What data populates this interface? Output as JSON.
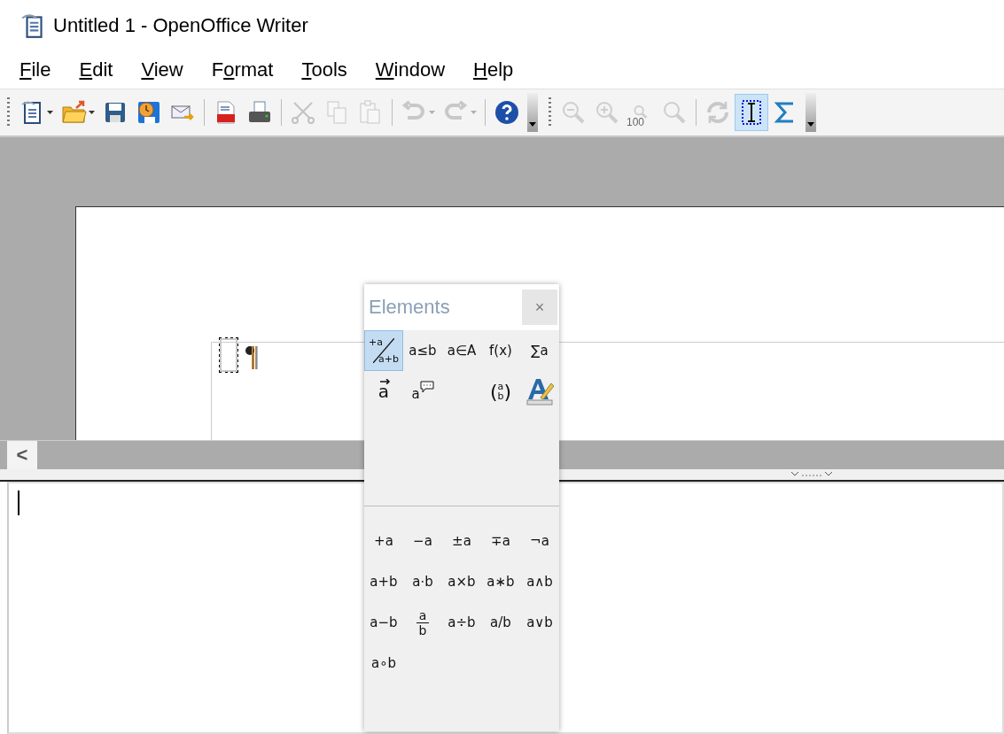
{
  "window": {
    "title": "Untitled 1 - OpenOffice Writer"
  },
  "menu": [
    {
      "key": "F",
      "post": "ile"
    },
    {
      "key": "E",
      "post": "dit"
    },
    {
      "key": "V",
      "post": "iew"
    },
    {
      "pre": "F",
      "key": "o",
      "post": "rmat"
    },
    {
      "key": "T",
      "post": "ools"
    },
    {
      "key": "W",
      "post": "indow"
    },
    {
      "key": "H",
      "post": "elp"
    }
  ],
  "toolbars": [
    {
      "groups": [
        [
          {
            "disabled": false,
            "selected": false,
            "dropdown": true
          },
          {
            "disabled": false,
            "selected": false,
            "dropdown": true
          },
          {
            "disabled": false,
            "selected": false
          },
          {
            "disabled": false,
            "selected": false
          },
          {
            "disabled": false,
            "selected": false
          }
        ],
        [
          {
            "disabled": false,
            "selected": false
          },
          {
            "disabled": false,
            "selected": false
          }
        ],
        [
          {
            "disabled": true,
            "selected": false
          },
          {
            "disabled": true,
            "selected": false
          },
          {
            "disabled": true,
            "selected": false
          }
        ],
        [
          {
            "disabled": true,
            "selected": false,
            "dropdown": true
          },
          {
            "disabled": true,
            "selected": false,
            "dropdown": true
          }
        ],
        [
          {
            "disabled": false,
            "selected": false
          }
        ]
      ]
    },
    {
      "groups": [
        [
          {
            "disabled": true,
            "selected": false
          },
          {
            "disabled": true,
            "selected": false
          },
          {
            "disabled": true,
            "selected": false,
            "label": "100"
          },
          {
            "disabled": true,
            "selected": false
          }
        ],
        [
          {
            "disabled": true,
            "selected": false
          },
          {
            "disabled": false,
            "selected": true
          },
          {
            "disabled": false,
            "selected": false
          }
        ]
      ]
    }
  ],
  "elements_panel": {
    "title": "Elements",
    "close": "×",
    "categories": [
      {
        "kind": "slash-fraction",
        "top": "+a",
        "bottom": "a+b",
        "selected": true
      },
      {
        "kind": "text",
        "label": "a≤b",
        "selected": false
      },
      {
        "kind": "text",
        "label": "a∈A",
        "selected": false
      },
      {
        "kind": "text",
        "label": "f(x)",
        "selected": false
      },
      {
        "kind": "text",
        "label": "∑a",
        "selected": false
      },
      {
        "kind": "vector",
        "label": "a",
        "selected": false
      },
      {
        "kind": "annotated",
        "label": "a",
        "selected": false
      },
      {
        "kind": "blank"
      },
      {
        "kind": "binomial",
        "open": "(",
        "top": "a",
        "bottom": "b",
        "close": ")",
        "selected": false
      },
      {
        "kind": "attributes",
        "selected": false
      }
    ],
    "elements": [
      {
        "kind": "text",
        "label": "+a"
      },
      {
        "kind": "text",
        "label": "−a"
      },
      {
        "kind": "text",
        "label": "±a"
      },
      {
        "kind": "text",
        "label": "∓a"
      },
      {
        "kind": "text",
        "label": "¬a"
      },
      {
        "kind": "text",
        "label": "a+b"
      },
      {
        "kind": "text",
        "label": "a⋅b"
      },
      {
        "kind": "text",
        "label": "a×b"
      },
      {
        "kind": "text",
        "label": "a∗b"
      },
      {
        "kind": "text",
        "label": "a∧b"
      },
      {
        "kind": "text",
        "label": "a−b"
      },
      {
        "kind": "fraction",
        "top": "a",
        "bottom": "b"
      },
      {
        "kind": "text",
        "label": "a÷b"
      },
      {
        "kind": "text",
        "label": "a/b"
      },
      {
        "kind": "text",
        "label": "a∨b"
      },
      {
        "kind": "text",
        "label": "a∘b"
      }
    ]
  },
  "document": {
    "scroll_left": "<"
  }
}
